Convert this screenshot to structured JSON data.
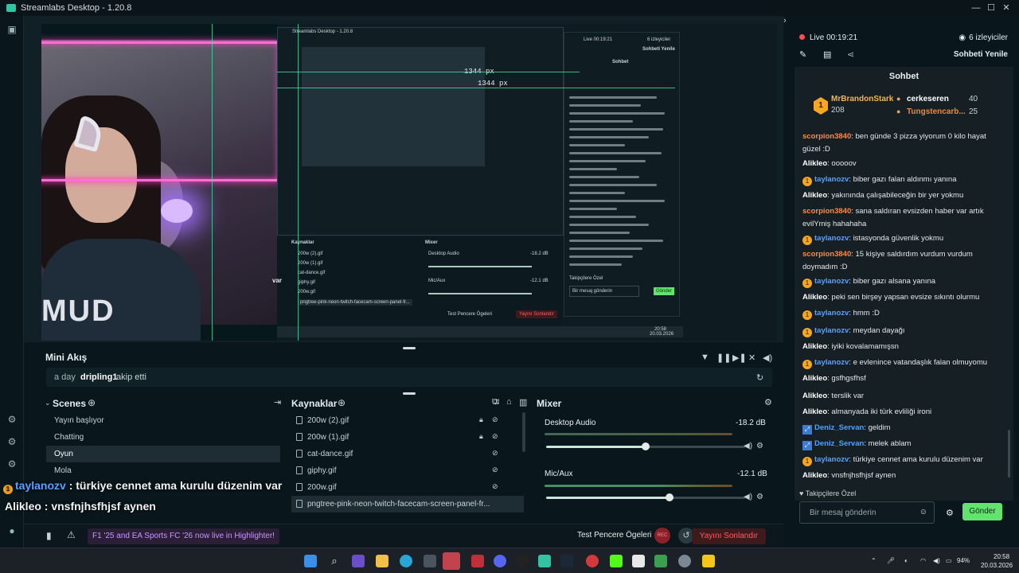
{
  "app": {
    "title": "Streamlabs Desktop - 1.20.8"
  },
  "window_controls": {
    "minimize": "—",
    "maximize": "☐",
    "close": "✕"
  },
  "preview": {
    "nested_title": "Streamlabs Desktop - 1.20.8",
    "px_readout_1": "1344 px",
    "px_readout_2": "1344 px",
    "shirt_text": "MUD",
    "nested_live": "Live 00:19:21",
    "nested_viewers": "6 izleyiciler",
    "nested_refresh": "Sohbeti Yenile",
    "nested_chat_title": "Sohbet",
    "nested_sources_title": "Kaynaklar",
    "nested_mixer_title": "Mixer",
    "nested_sources": [
      "200w (2).gif",
      "200w (1).gif",
      "cat-dance.gif",
      "giphy.gif",
      "200w.gif",
      "pngtree-pink-neon-twitch-facecam-screen-panel-fr..."
    ],
    "nested_desktop_audio": "Desktop Audio",
    "nested_desktop_db": "-18.2 dB",
    "nested_mic": "Mic/Aux",
    "nested_mic_db": "-12.1 dB",
    "nested_test": "Test Pencere Ögeleri",
    "nested_end": "Yayını Sonlandır",
    "nested_input": "Bir mesaj gönderin",
    "nested_send": "Gönder",
    "nested_priv": "Takipçilere Özel",
    "nested_time": "20:58",
    "nested_date": "20.03.2026",
    "nested_var": "var"
  },
  "mini_feed": {
    "title": "Mini Akış",
    "time": "a day",
    "user": "dripling1",
    "action": "takip etti"
  },
  "scenes": {
    "title": "Scenes",
    "items": [
      "Yayın başlıyor",
      "Chatting",
      "Oyun",
      "Mola",
      "",
      ""
    ],
    "active_index": 2
  },
  "sources": {
    "title": "Kaynaklar",
    "items": [
      "200w (2).gif",
      "200w (1).gif",
      "cat-dance.gif",
      "giphy.gif",
      "200w.gif",
      "pngtree-pink-neon-twitch-facecam-screen-panel-fr..."
    ]
  },
  "mixer": {
    "title": "Mixer",
    "desktop_label": "Desktop Audio",
    "desktop_db": "-18.2 dB",
    "desktop_volume": 0.5,
    "mic_label": "Mic/Aux",
    "mic_db": "-12.1 dB",
    "mic_volume": 0.62
  },
  "overlay_chat": {
    "line1_user": "taylanozv",
    "line1_text": " : türkiye cennet ama kurulu düzenim var",
    "line2_user": "Alikleo",
    "line2_text": " : vnsfnjhsfhjsf aynen"
  },
  "bottom": {
    "highlight": "F1 '25 and EA Sports FC '26 now live in Highlighter!",
    "test_label": "Test Pencere Ögeleri",
    "rec_label": "REC",
    "end_stream": "Yayını Sonlandır"
  },
  "right": {
    "live": "Live 00:19:21",
    "viewers": "6 izleyiciler",
    "refresh": "Sohbeti Yenile",
    "chat_title": "Sohbet",
    "leader_name": "MrBrandonStark",
    "leader_count": "208",
    "top2_name": "cerkeseren",
    "top2_val": "40",
    "top3_name": "Tungstencarb...",
    "top3_val": "25",
    "private_label": "Takipçilere Özel",
    "input_placeholder": "Bir mesaj gönderin",
    "send": "Gönder",
    "messages": [
      {
        "user": "scorpion3840",
        "text": ": ben günde 3 pizza yiyorum 0 kilo hayat güzel :D",
        "badge": "",
        "color": "#ff8a3d"
      },
      {
        "user": "Alikleo",
        "text": ": ooooov",
        "badge": "",
        "color": "#ffffff"
      },
      {
        "user": "taylanozv",
        "text": ": biber gazı falan aldınmı yanına",
        "badge": "1",
        "color": "#5aa0ff"
      },
      {
        "user": "Alikleo",
        "text": ": yakınında çalışabileceğin bir yer yokmu",
        "badge": "",
        "color": "#ffffff"
      },
      {
        "user": "scorpion3840",
        "text": ": sana saldıran evsizden haber var artık evilYmiş hahahaha",
        "badge": "",
        "color": "#ff8a3d"
      },
      {
        "user": "taylanozv",
        "text": ": istasyonda güvenlik yokmu",
        "badge": "1",
        "color": "#5aa0ff"
      },
      {
        "user": "scorpion3840",
        "text": ": 15 kişiye saldırdım vurdum vurdum doymadım :D",
        "badge": "",
        "color": "#ff8a3d"
      },
      {
        "user": "taylanozv",
        "text": ": biber gazı alsana yanına",
        "badge": "1",
        "color": "#5aa0ff"
      },
      {
        "user": "Alikleo",
        "text": ": peki sen birşey yapsan evsize sıkıntı olurmu",
        "badge": "",
        "color": "#ffffff"
      },
      {
        "user": "taylanozv",
        "text": ": hmm :D",
        "badge": "1",
        "color": "#5aa0ff"
      },
      {
        "user": "taylanozv",
        "text": ": meydan dayağı",
        "badge": "1",
        "color": "#5aa0ff"
      },
      {
        "user": "Alikleo",
        "text": ": iyiki kovalamamışsn",
        "badge": "",
        "color": "#ffffff"
      },
      {
        "user": "taylanozv",
        "text": ": e evlenince vatandaşlık falan olmuyomu",
        "badge": "1",
        "color": "#5aa0ff"
      },
      {
        "user": "Alikleo",
        "text": ": gsfhgsfhsf",
        "badge": "",
        "color": "#ffffff"
      },
      {
        "user": "Alikleo",
        "text": ": terslik var",
        "badge": "",
        "color": "#ffffff"
      },
      {
        "user": "Alikleo",
        "text": ": almanyada iki türk evliliği ironi",
        "badge": "",
        "color": "#ffffff"
      },
      {
        "user": "Deniz_Servan",
        "text": ": geldim",
        "badge": "x",
        "color": "#4aa3ff"
      },
      {
        "user": "Deniz_Servan",
        "text": ": melek ablam",
        "badge": "x",
        "color": "#4aa3ff"
      },
      {
        "user": "taylanozv",
        "text": ": türkiye cennet ama kurulu düzenim var",
        "badge": "1",
        "color": "#5aa0ff"
      },
      {
        "user": "Alikleo",
        "text": ": vnsfnjhsfhjsf aynen",
        "badge": "",
        "color": "#ffffff"
      }
    ]
  },
  "system_tray": {
    "battery": "94%",
    "time": "20:58",
    "date": "20.03.2026"
  },
  "colors": {
    "accent": "#62e36d",
    "neon": "#ff6fd1",
    "live": "#ff4d4d"
  }
}
